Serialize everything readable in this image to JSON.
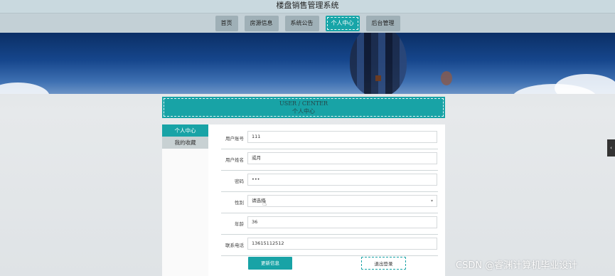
{
  "app": {
    "title": "楼盘销售管理系统"
  },
  "nav": {
    "items": [
      "首页",
      "房源信息",
      "系统公告",
      "个人中心",
      "后台管理"
    ],
    "active_index": 3
  },
  "panel": {
    "title_en": "USER / CENTER",
    "title_cn": "个人中心"
  },
  "sidebar": {
    "items": [
      {
        "label": "个人中心",
        "active": true
      },
      {
        "label": "我的收藏",
        "active": false
      }
    ]
  },
  "form": {
    "account": {
      "label": "用户账号",
      "value": "111"
    },
    "name": {
      "label": "用户姓名",
      "value": "或月"
    },
    "password": {
      "label": "密码",
      "value": "•••"
    },
    "gender": {
      "label": "性别",
      "placeholder": "请选择"
    },
    "age": {
      "label": "年龄",
      "value": "36"
    },
    "phone": {
      "label": "联系电话",
      "value": "13615112512"
    }
  },
  "buttons": {
    "update": "更新信息",
    "logout": "退出登录"
  },
  "watermark": "CSDN @睿渊计算机毕业设计",
  "colors": {
    "accent": "#18a3a6",
    "nav_bg": "#c3d0d6"
  },
  "icons": {
    "select_caret": "chevron-down-icon",
    "cursor": "hand-cursor-icon",
    "edge_tab": "chevron-left-icon"
  }
}
